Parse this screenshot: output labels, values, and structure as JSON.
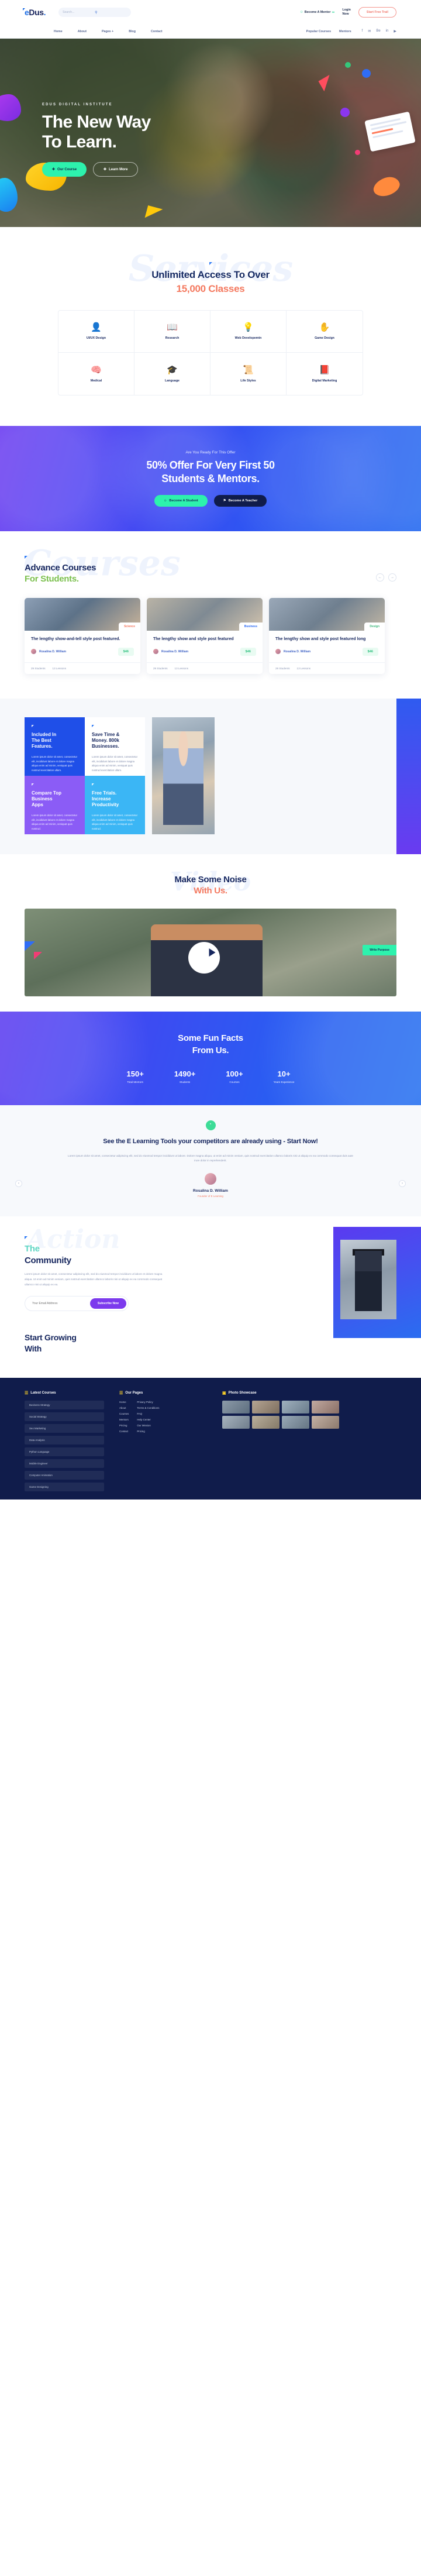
{
  "header": {
    "logo": "eDus.",
    "logo_e": "e",
    "logo_rest": "Dus",
    "logo_dot": ".",
    "search_placeholder": "Search...",
    "search_icon": "search-icon",
    "mentor_label": "Become A Mentor",
    "mentor_icon_left": "user-icon",
    "mentor_icon_right": "key-icon",
    "login_line1": "Login",
    "login_line2": "Now",
    "trial_label": "Start Free Trail"
  },
  "nav": {
    "links": [
      "Home",
      "About",
      "Pages +",
      "Blog",
      "Contact"
    ],
    "right_links": [
      "Popular Courses",
      "Mentors"
    ],
    "socials": [
      "facebook-icon",
      "twitter-icon",
      "behance-icon",
      "linkedin-icon",
      "youtube-icon"
    ],
    "social_glyphs": [
      "f",
      "✉",
      "Be",
      "in",
      "▶"
    ]
  },
  "hero": {
    "kicker": "EDUS DIGITAL INSTITUTE",
    "title_line1": "The New Way",
    "title_line2": "To Learn.",
    "btn_primary": "Our Course",
    "btn_secondary": "Learn More",
    "btn_icon": "plus-icon"
  },
  "services": {
    "ghost_word": "Services",
    "title_line1": "Unlimited Access To Over",
    "title_line2": "15,000 Classes",
    "items": [
      {
        "label": "UI/UX Design",
        "icon": "person-design-icon",
        "glyph": "👤",
        "color": "#f0305e"
      },
      {
        "label": "Research",
        "icon": "book-search-icon",
        "glyph": "📖",
        "color": "#121212"
      },
      {
        "label": "Web Developemtn",
        "icon": "lightbulb-icon",
        "glyph": "💡",
        "color": "#7cc04f"
      },
      {
        "label": "Game Design",
        "icon": "hands-icon",
        "glyph": "✋",
        "color": "#2f7bf6"
      },
      {
        "label": "Medical",
        "icon": "brain-icon",
        "glyph": "🧠",
        "color": "#3fc0a0"
      },
      {
        "label": "Language",
        "icon": "graduation-cap-icon",
        "glyph": "🎓",
        "color": "#f2629a"
      },
      {
        "label": "Life Styles",
        "icon": "certificate-icon",
        "glyph": "📜",
        "color": "#a855f7"
      },
      {
        "label": "Digital Marketing",
        "icon": "book-flask-icon",
        "glyph": "📕",
        "color": "#f07820"
      }
    ]
  },
  "offer": {
    "kicker": "Are You Ready For This Offer",
    "title_line1": "50% Offer For Very First 50",
    "title_line2": "Students & Mentors.",
    "btn_student": "Become A Student",
    "btn_teacher": "Become A Teacher",
    "btn_student_icon": "user-icon",
    "btn_teacher_icon": "flag-icon"
  },
  "courses": {
    "ghost_word": "Courses",
    "title_line1": "Advance Courses",
    "title_line2": "For Students.",
    "prev_icon": "arrow-left-icon",
    "next_icon": "arrow-right-icon",
    "prev_glyph": "←",
    "next_glyph": "→",
    "cards": [
      {
        "tag": "Science",
        "title": "The lengthy show-and-tell style post featured.",
        "author": "Rosalina D. William",
        "price": "$46",
        "meta_students": "29 Students",
        "meta_lessons": "13 Lessons"
      },
      {
        "tag": "Business",
        "title": "The lengthy show and style post featured",
        "author": "Rosalina D. William",
        "price": "$46",
        "meta_students": "29 Students",
        "meta_lessons": "13 Lessons"
      },
      {
        "tag": "Design",
        "title": "The lengthy show and style post featured long",
        "author": "Rosalina D. William",
        "price": "$46",
        "meta_students": "29 Students",
        "meta_lessons": "13 Lessons"
      }
    ]
  },
  "features": {
    "boxes": [
      {
        "title_line1": "Included In",
        "title_line2": "The Best",
        "title_line3": "Features.",
        "text": "Lorem ipsum dolor sit amet, consectetur elit, incididunt labore et dolore magna aliqua enim ad minim, veniquat quis nostrud exercitation ullam."
      },
      {
        "title_line1": "Save Time &",
        "title_line2": "Money. 800k",
        "title_line3": "Businesses.",
        "text": "Lorem ipsum dolor sit amet, consectetur elit, incididunt labore et dolore magna aliqua enim ad minim, veniquat quis nostrud exercitation ullam."
      },
      {
        "title_line1": "Compare Top",
        "title_line2": "Business",
        "title_line3": "Apps",
        "text": "Lorem ipsum dolor sit amet, consectetur elit, incididunt labore et dolore magna aliqua enim ad minim, veniquat quis nostrud."
      },
      {
        "title_line1": "Free Trials.",
        "title_line2": "Increase",
        "title_line3": "Productivity",
        "text": "Lorem ipsum dolor sit amet, consectetur elit, incididunt labore et dolore magna aliqua enim ad minim, veniquat quis nostrud."
      }
    ]
  },
  "video": {
    "ghost_word": "Video",
    "title_line1": "Make Some Noise",
    "title_line2": "With Us.",
    "play_icon": "play-icon",
    "badge": "Write Purpose"
  },
  "facts": {
    "title_line1": "Some Fun Facts",
    "title_line2": "From Us.",
    "stats": [
      {
        "number": "150+",
        "label": "Total Mentors"
      },
      {
        "number": "1490+",
        "label": "Students"
      },
      {
        "number": "100+",
        "label": "Courses"
      },
      {
        "number": "10+",
        "label": "Years Experience"
      }
    ]
  },
  "testimonial": {
    "badge_icon": "quote-icon",
    "badge_glyph": "”",
    "title": "See the E Learning Tools your competitors are already using - Start Now!",
    "text": "Lorem ipsum dolor sit amet, consectetur adipiscing elit, sed do eiusmod tempor incididunt ut labore. Dolore magna aliqua, ut enim ad minim veniam, quis nostrud exercitation ullamco laboris nisi ut aliquip ex ea commodo consequat duis aute irure dolor in reprehenderit.",
    "author": "Rosalina D. William",
    "role": "Founder of E Learning",
    "prev_glyph": "‹",
    "next_glyph": "›"
  },
  "community": {
    "ghost_word": "Action",
    "title_line1": "The",
    "title_line2": "Community",
    "text": "Lorem ipsum dolor sit amet, consectetur adipiscing elit, sed do eiusmod tempor incididunt ut labore et dolore magna aliqua. Ut enim ad minim veniam, quis nostrud exercitation ullamco laboris nisi ut aliquip ex ea commodo consequat ullamco nisi ut aliquip ex ea.",
    "email_placeholder": "Your Email Address",
    "subscribe_label": "Subscribe Now",
    "grow_line1": "Start Growing",
    "grow_line2": "With"
  },
  "footer": {
    "col1_title": "Latest Courses",
    "col1_icon": "list-icon",
    "col1_items": [
      "Business Strategy",
      "Social Strategy",
      "Seo Marketing",
      "Data Analysis",
      "Python Language",
      "Mobile Engineer",
      "Computer Animation",
      "Game Designing"
    ],
    "col2_title": "Our Pages",
    "col2_icon": "pages-icon",
    "col2_a": [
      "Home",
      "About",
      "Courses",
      "Mentors",
      "Pricing",
      "Contact"
    ],
    "col2_b": [
      "Privacy Policy",
      "Terms & Conditions",
      "FAQ",
      "Help Center",
      "Our Mission",
      "Pricing"
    ],
    "col3_title": "Photo Showcase",
    "col3_icon": "camera-icon",
    "photos": [
      "photo-1",
      "photo-2",
      "photo-3",
      "photo-4",
      "photo-5",
      "photo-6",
      "photo-7",
      "photo-8"
    ]
  }
}
